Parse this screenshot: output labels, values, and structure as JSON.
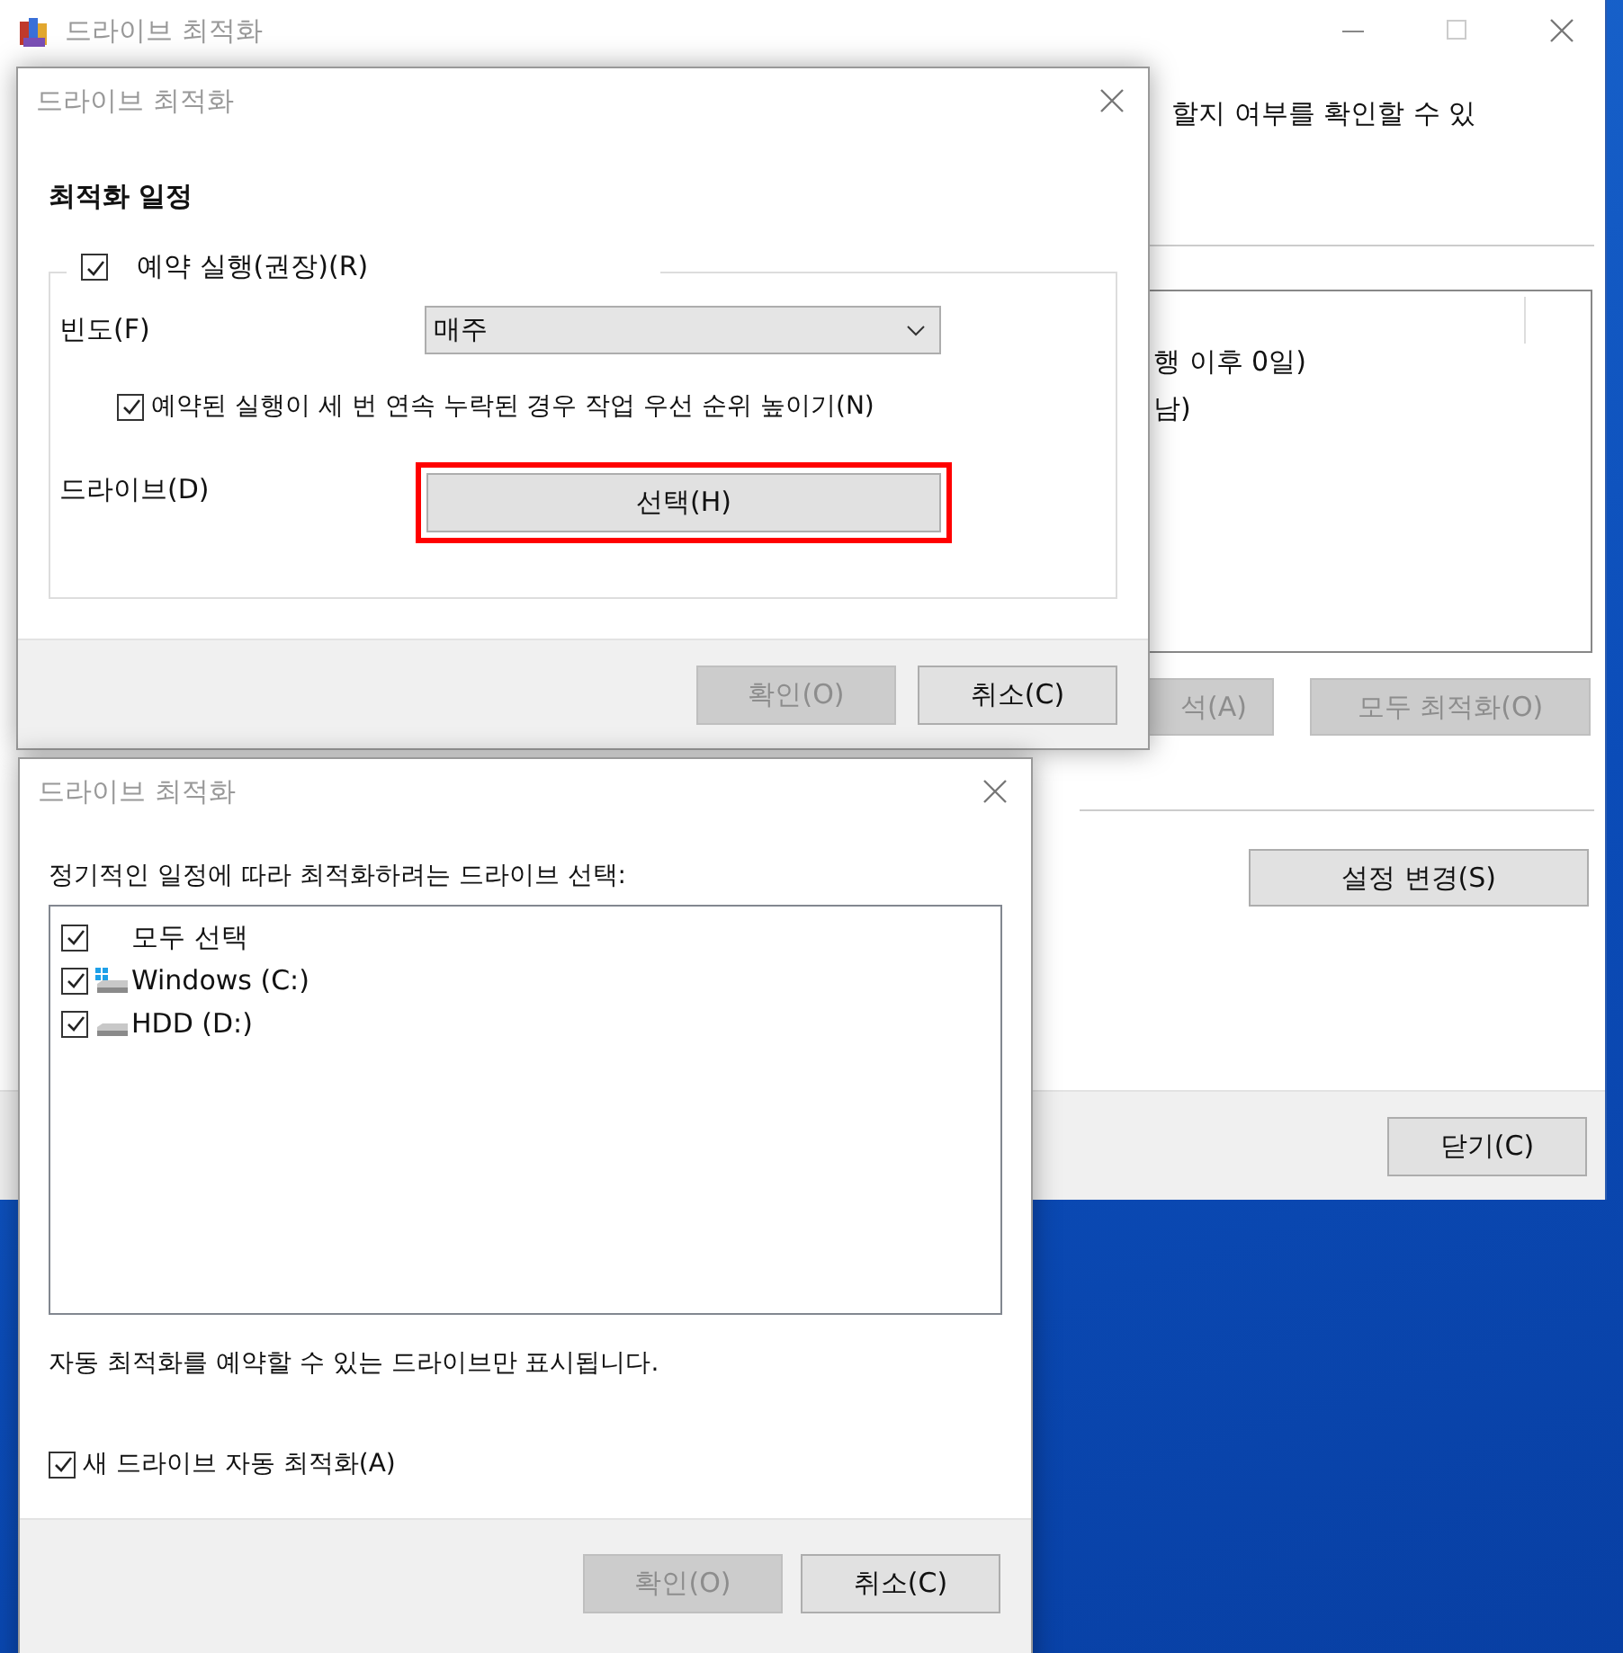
{
  "back_window": {
    "title": "드라이브 최적화",
    "description_fragment": "할지 여부를 확인할 수 있",
    "list_lines": [
      "행 이후 0일)",
      "남)"
    ],
    "buttons": [
      {
        "label": "석(A)",
        "disabled": true
      },
      {
        "label": "모두 최적화(O)",
        "disabled": true
      }
    ],
    "settings_button": {
      "label": "설정 변경(S)",
      "disabled": false
    },
    "close_button": {
      "label": "닫기(C)",
      "disabled": false
    }
  },
  "schedule_dialog": {
    "title": "드라이브 최적화",
    "heading": "최적화 일정",
    "run_on_schedule": {
      "label": "예약 실행(권장)(R)",
      "checked": true
    },
    "frequency": {
      "label": "빈도(F)",
      "value": "매주"
    },
    "increase_priority": {
      "label": "예약된 실행이 세 번 연속 누락된 경우 작업 우선 순위 높이기(N)",
      "checked": true
    },
    "drives": {
      "label": "드라이브(D)",
      "button": {
        "label": "선택(H)",
        "highlighted": true
      }
    },
    "buttons": [
      {
        "label": "확인(O)",
        "disabled": true
      },
      {
        "label": "취소(C)",
        "disabled": false
      }
    ]
  },
  "drive_dialog": {
    "title": "드라이브 최적화",
    "prompt": "정기적인 일정에 따라 최적화하려는 드라이브 선택:",
    "items": [
      {
        "label": "모두 선택",
        "kind": "all",
        "checked": true
      },
      {
        "label": "Windows (C:)",
        "kind": "system",
        "checked": true
      },
      {
        "label": "HDD (D:)",
        "kind": "hdd",
        "checked": true
      }
    ],
    "note": "자동 최적화를 예약할 수 있는 드라이브만 표시됩니다.",
    "auto_new": {
      "label": "새 드라이브 자동 최적화(A)",
      "checked": true
    },
    "buttons": [
      {
        "label": "확인(O)",
        "disabled": true
      },
      {
        "label": "취소(C)",
        "disabled": false
      }
    ]
  }
}
